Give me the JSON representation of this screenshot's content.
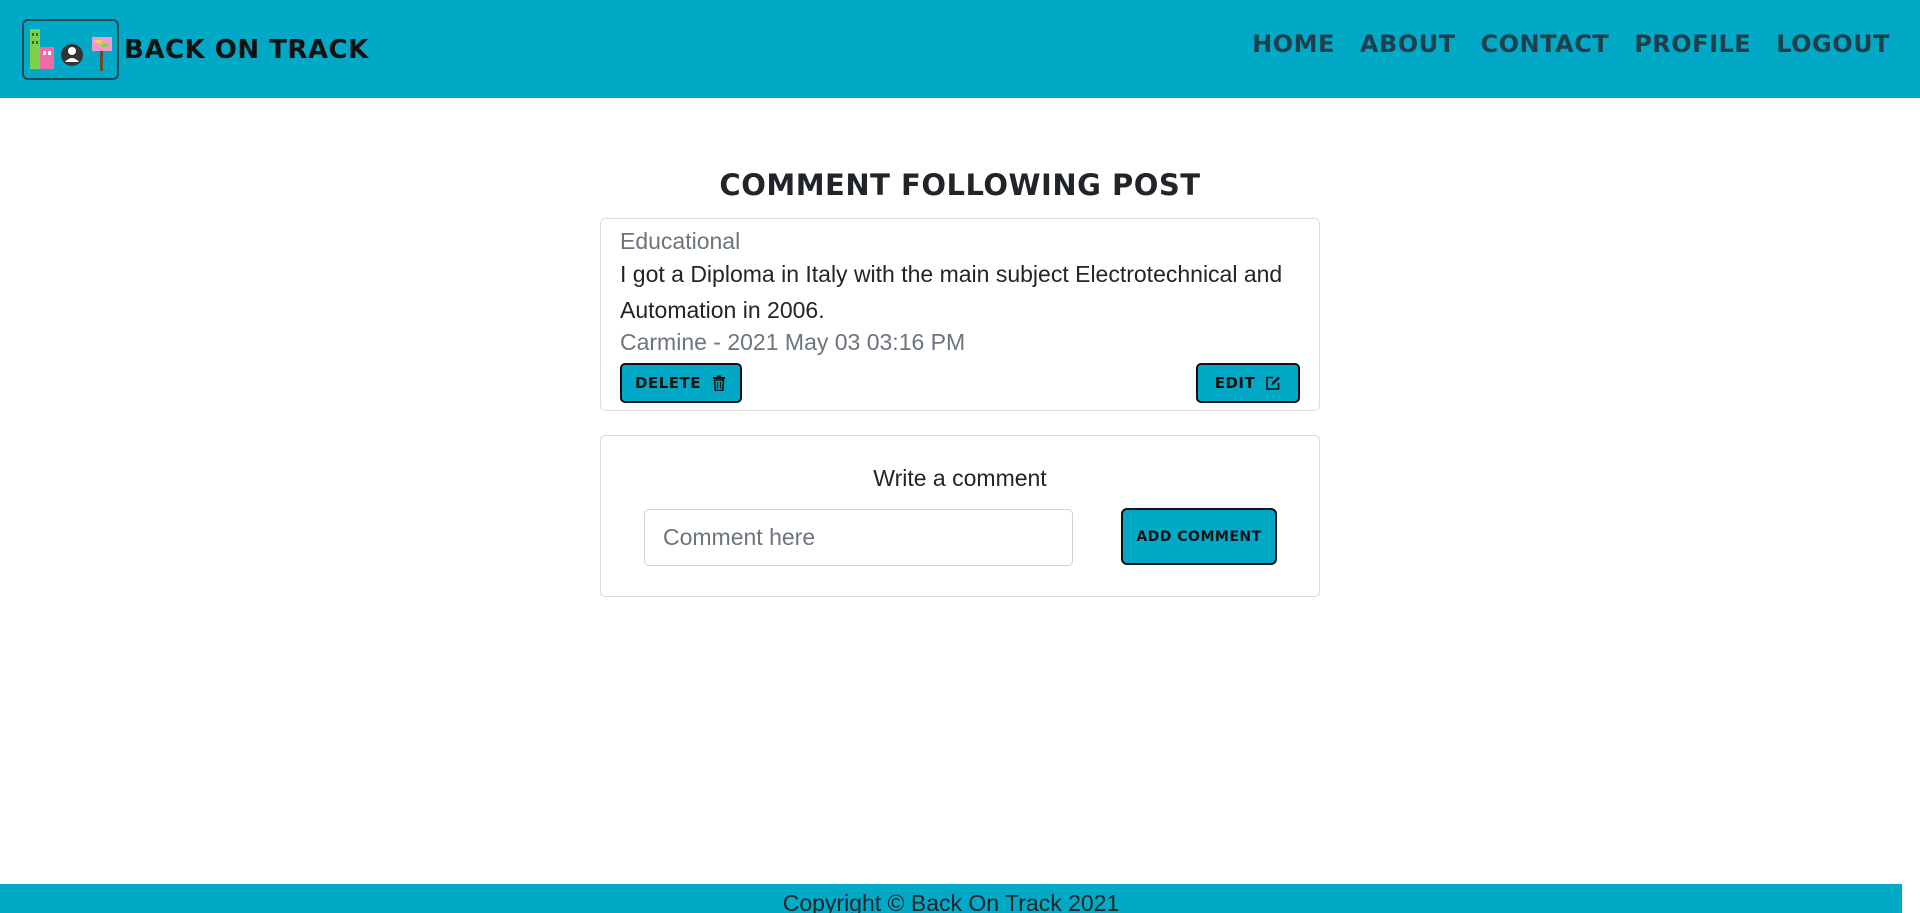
{
  "colors": {
    "accent": "#02a9c7",
    "text": "#212529",
    "muted": "#6c757d"
  },
  "header": {
    "brand": "BACK ON TRACK",
    "logo_icon": "back-on-track-logo",
    "nav": [
      "HOME",
      "ABOUT",
      "CONTACT",
      "PROFILE",
      "LOGOUT"
    ]
  },
  "main": {
    "title": "COMMENT FOLLOWING POST",
    "post": {
      "category": "Educational",
      "body": "I got a Diploma in Italy with the main subject Electrotechnical and Automation in 2006.",
      "meta": "Carmine - 2021 May 03 03:16 PM",
      "delete_label": "DELETE",
      "delete_icon": "trash-icon",
      "edit_label": "EDIT",
      "edit_icon": "edit-icon"
    },
    "comment_form": {
      "heading": "Write a comment",
      "placeholder": "Comment here",
      "value": "",
      "submit_label": "ADD COMMENT"
    }
  },
  "footer": {
    "copyright": "Copyright © Back On Track 2021"
  }
}
